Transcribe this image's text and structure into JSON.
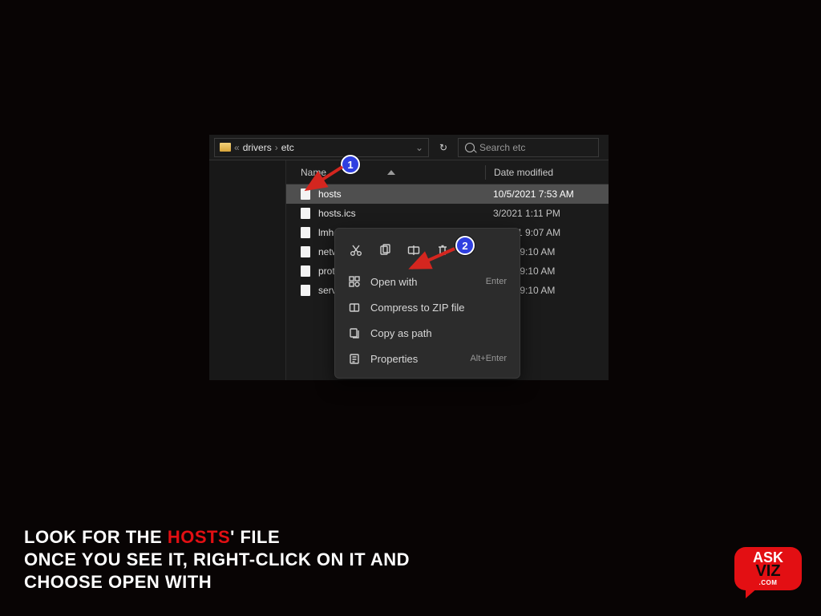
{
  "breadcrumb": {
    "prefix_glyph": "«",
    "seg1": "drivers",
    "sep": "›",
    "seg2": "etc"
  },
  "nav": {
    "history_glyph": "⌄",
    "refresh_glyph": "↻"
  },
  "search": {
    "placeholder": "Search etc"
  },
  "columns": {
    "name": "Name",
    "date": "Date modified"
  },
  "files": [
    {
      "name": "hosts",
      "date": "10/5/2021 7:53 AM"
    },
    {
      "name": "hosts.ics",
      "date": "3/2021 1:11 PM"
    },
    {
      "name": "lmhosts.sa",
      "date": "5/2021 9:07 AM"
    },
    {
      "name": "networks",
      "date": "/2021 9:10 AM"
    },
    {
      "name": "protocol",
      "date": "/2021 9:10 AM"
    },
    {
      "name": "services",
      "date": "/2021 9:10 AM"
    }
  ],
  "ctx": {
    "open_with": {
      "label": "Open with",
      "accel": "Enter"
    },
    "compress": {
      "label": "Compress to ZIP file"
    },
    "copy_path": {
      "label": "Copy as path"
    },
    "properties": {
      "label": "Properties",
      "accel": "Alt+Enter"
    }
  },
  "annotations": {
    "step1": "1",
    "step2": "2"
  },
  "caption": {
    "pre": "LOOK FOR THE ",
    "highlight": "HOSTS",
    "post": "' FILE",
    "line2": "ONCE YOU SEE IT, RIGHT-CLICK ON IT AND",
    "line3": "CHOOSE OPEN WITH"
  },
  "brand": {
    "line1": "ASK",
    "line2": "VIZ",
    "line3": ".COM"
  }
}
